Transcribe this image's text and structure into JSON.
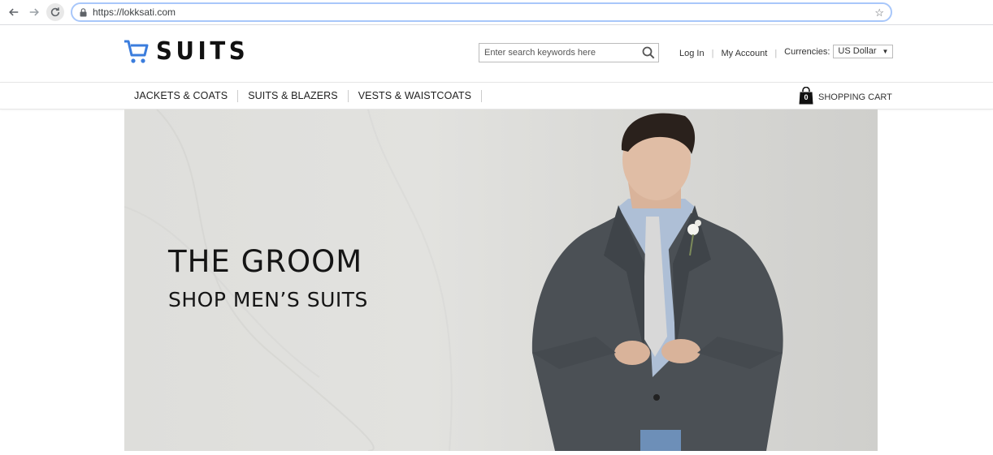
{
  "browser": {
    "url": "https://lokksati.com",
    "icons": [
      "back-arrow-icon",
      "forward-arrow-icon",
      "reload-icon",
      "lock-icon",
      "bookmark-star-icon"
    ]
  },
  "header": {
    "logo_text": "SUITS",
    "search_placeholder": "Enter search keywords here",
    "login_label": "Log In",
    "account_label": "My Account",
    "currencies_label": "Currencies:",
    "currency_value": "US Dollar"
  },
  "nav": {
    "items": [
      {
        "label": "JACKETS & COATS"
      },
      {
        "label": "SUITS & BLAZERS"
      },
      {
        "label": "VESTS & WAISTCOATS"
      }
    ],
    "cart_count": "0",
    "cart_label": "SHOPPING CART"
  },
  "hero": {
    "title": "THE GROOM",
    "subtitle": "SHOP MEN’S SUITS"
  },
  "colors": {
    "accent": "#3b7ddd",
    "omnibox_border": "#a8c7fa"
  }
}
